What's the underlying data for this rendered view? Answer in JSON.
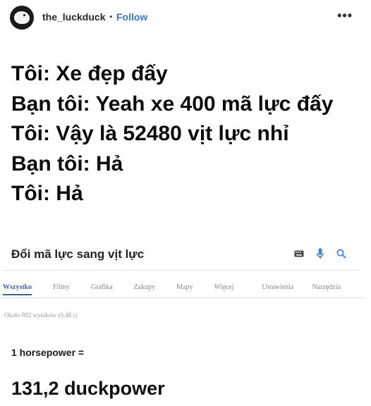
{
  "header": {
    "username": "the_luckduck",
    "separator": "•",
    "follow_label": "Follow",
    "more_label": "•••"
  },
  "dialogue": {
    "lines": [
      "Tôi: Xe đẹp đấy",
      "Bạn tôi: Yeah xe 400 mã lực đấy",
      "Tôi: Vậy là 52480 vịt lực nhỉ",
      "Bạn tôi: Hả",
      "Tôi: Hả"
    ]
  },
  "search": {
    "query": "Đổi mã lực sang vịt lực",
    "icons": [
      "keyboard-icon",
      "microphone-icon",
      "search-icon"
    ],
    "tabs": [
      {
        "label": "Wszystko",
        "active": true
      },
      {
        "label": "Filmy",
        "active": false
      },
      {
        "label": "Grafika",
        "active": false
      },
      {
        "label": "Zakupy",
        "active": false
      },
      {
        "label": "Mapy",
        "active": false
      },
      {
        "label": "Więcej",
        "active": false
      },
      {
        "label": "Ustawienia",
        "active": false
      },
      {
        "label": "Narzędzia",
        "active": false
      }
    ],
    "results_count": "Około 892 wyników (0,48 s)",
    "conversion_label": "1 horsepower =",
    "conversion_result": "131,2 duckpower"
  },
  "colors": {
    "follow": "#3a76c5",
    "active_tab": "#3d63b8"
  }
}
